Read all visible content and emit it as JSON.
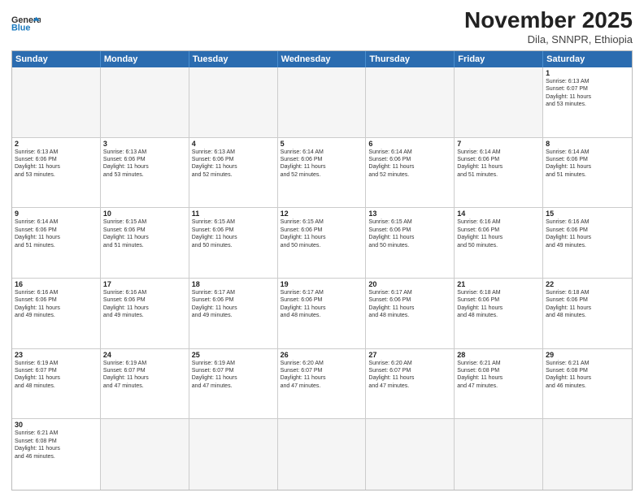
{
  "header": {
    "logo_general": "General",
    "logo_blue": "Blue",
    "month_title": "November 2025",
    "location": "Dila, SNNPR, Ethiopia"
  },
  "days_of_week": [
    "Sunday",
    "Monday",
    "Tuesday",
    "Wednesday",
    "Thursday",
    "Friday",
    "Saturday"
  ],
  "weeks": [
    [
      {
        "day": "",
        "info": ""
      },
      {
        "day": "",
        "info": ""
      },
      {
        "day": "",
        "info": ""
      },
      {
        "day": "",
        "info": ""
      },
      {
        "day": "",
        "info": ""
      },
      {
        "day": "",
        "info": ""
      },
      {
        "day": "1",
        "info": "Sunrise: 6:13 AM\nSunset: 6:07 PM\nDaylight: 11 hours\nand 53 minutes."
      }
    ],
    [
      {
        "day": "2",
        "info": "Sunrise: 6:13 AM\nSunset: 6:06 PM\nDaylight: 11 hours\nand 53 minutes."
      },
      {
        "day": "3",
        "info": "Sunrise: 6:13 AM\nSunset: 6:06 PM\nDaylight: 11 hours\nand 53 minutes."
      },
      {
        "day": "4",
        "info": "Sunrise: 6:13 AM\nSunset: 6:06 PM\nDaylight: 11 hours\nand 52 minutes."
      },
      {
        "day": "5",
        "info": "Sunrise: 6:14 AM\nSunset: 6:06 PM\nDaylight: 11 hours\nand 52 minutes."
      },
      {
        "day": "6",
        "info": "Sunrise: 6:14 AM\nSunset: 6:06 PM\nDaylight: 11 hours\nand 52 minutes."
      },
      {
        "day": "7",
        "info": "Sunrise: 6:14 AM\nSunset: 6:06 PM\nDaylight: 11 hours\nand 51 minutes."
      },
      {
        "day": "8",
        "info": "Sunrise: 6:14 AM\nSunset: 6:06 PM\nDaylight: 11 hours\nand 51 minutes."
      }
    ],
    [
      {
        "day": "9",
        "info": "Sunrise: 6:14 AM\nSunset: 6:06 PM\nDaylight: 11 hours\nand 51 minutes."
      },
      {
        "day": "10",
        "info": "Sunrise: 6:15 AM\nSunset: 6:06 PM\nDaylight: 11 hours\nand 51 minutes."
      },
      {
        "day": "11",
        "info": "Sunrise: 6:15 AM\nSunset: 6:06 PM\nDaylight: 11 hours\nand 50 minutes."
      },
      {
        "day": "12",
        "info": "Sunrise: 6:15 AM\nSunset: 6:06 PM\nDaylight: 11 hours\nand 50 minutes."
      },
      {
        "day": "13",
        "info": "Sunrise: 6:15 AM\nSunset: 6:06 PM\nDaylight: 11 hours\nand 50 minutes."
      },
      {
        "day": "14",
        "info": "Sunrise: 6:16 AM\nSunset: 6:06 PM\nDaylight: 11 hours\nand 50 minutes."
      },
      {
        "day": "15",
        "info": "Sunrise: 6:16 AM\nSunset: 6:06 PM\nDaylight: 11 hours\nand 49 minutes."
      }
    ],
    [
      {
        "day": "16",
        "info": "Sunrise: 6:16 AM\nSunset: 6:06 PM\nDaylight: 11 hours\nand 49 minutes."
      },
      {
        "day": "17",
        "info": "Sunrise: 6:16 AM\nSunset: 6:06 PM\nDaylight: 11 hours\nand 49 minutes."
      },
      {
        "day": "18",
        "info": "Sunrise: 6:17 AM\nSunset: 6:06 PM\nDaylight: 11 hours\nand 49 minutes."
      },
      {
        "day": "19",
        "info": "Sunrise: 6:17 AM\nSunset: 6:06 PM\nDaylight: 11 hours\nand 48 minutes."
      },
      {
        "day": "20",
        "info": "Sunrise: 6:17 AM\nSunset: 6:06 PM\nDaylight: 11 hours\nand 48 minutes."
      },
      {
        "day": "21",
        "info": "Sunrise: 6:18 AM\nSunset: 6:06 PM\nDaylight: 11 hours\nand 48 minutes."
      },
      {
        "day": "22",
        "info": "Sunrise: 6:18 AM\nSunset: 6:06 PM\nDaylight: 11 hours\nand 48 minutes."
      }
    ],
    [
      {
        "day": "23",
        "info": "Sunrise: 6:19 AM\nSunset: 6:07 PM\nDaylight: 11 hours\nand 48 minutes."
      },
      {
        "day": "24",
        "info": "Sunrise: 6:19 AM\nSunset: 6:07 PM\nDaylight: 11 hours\nand 47 minutes."
      },
      {
        "day": "25",
        "info": "Sunrise: 6:19 AM\nSunset: 6:07 PM\nDaylight: 11 hours\nand 47 minutes."
      },
      {
        "day": "26",
        "info": "Sunrise: 6:20 AM\nSunset: 6:07 PM\nDaylight: 11 hours\nand 47 minutes."
      },
      {
        "day": "27",
        "info": "Sunrise: 6:20 AM\nSunset: 6:07 PM\nDaylight: 11 hours\nand 47 minutes."
      },
      {
        "day": "28",
        "info": "Sunrise: 6:21 AM\nSunset: 6:08 PM\nDaylight: 11 hours\nand 47 minutes."
      },
      {
        "day": "29",
        "info": "Sunrise: 6:21 AM\nSunset: 6:08 PM\nDaylight: 11 hours\nand 46 minutes."
      }
    ],
    [
      {
        "day": "30",
        "info": "Sunrise: 6:21 AM\nSunset: 6:08 PM\nDaylight: 11 hours\nand 46 minutes."
      },
      {
        "day": "",
        "info": ""
      },
      {
        "day": "",
        "info": ""
      },
      {
        "day": "",
        "info": ""
      },
      {
        "day": "",
        "info": ""
      },
      {
        "day": "",
        "info": ""
      },
      {
        "day": "",
        "info": ""
      }
    ]
  ]
}
